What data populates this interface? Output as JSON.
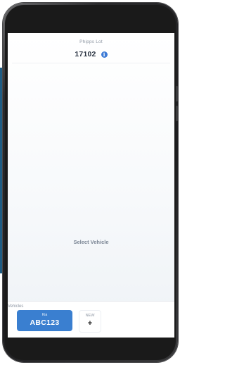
{
  "header": {
    "lot_name": "Phipps Lot",
    "lot_number": "17102",
    "info_icon": "info-icon"
  },
  "main": {
    "empty_state": "Select Vehicle"
  },
  "vehicles": {
    "label": "Vehicles",
    "items": [
      {
        "make": "Kia",
        "plate": "ABC123"
      }
    ],
    "new_button": {
      "label": "NEW",
      "icon_glyph": "+"
    }
  },
  "colors": {
    "accent": "#3a7fd0",
    "info_icon": "#3d7bd6",
    "frame": "#1d1d1f",
    "background_stripe": "#1f5c83"
  }
}
